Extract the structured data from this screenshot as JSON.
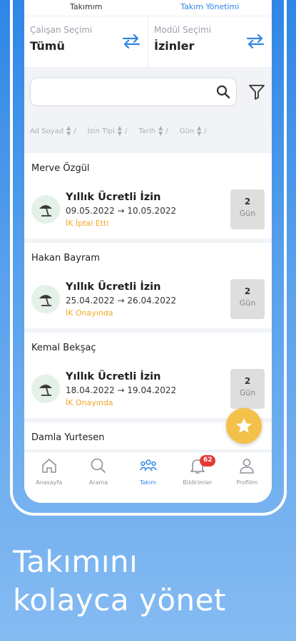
{
  "tabs": {
    "team": "Takımım",
    "management": "Takım Yönetimi"
  },
  "selectors": {
    "employee": {
      "label": "Çalışan Seçimi",
      "value": "Tümü"
    },
    "module": {
      "label": "Modül Seçimi",
      "value": "İzinler"
    }
  },
  "search": {
    "placeholder": ""
  },
  "sort_columns": [
    "Ad Soyad",
    "İzin Tipi",
    "Tarih",
    "Gün"
  ],
  "leaves": [
    {
      "name": "Merve Özgül",
      "type": "Yıllık Ücretli İzin",
      "dates": "09.05.2022 → 10.05.2022",
      "status": "İK İptal Etti",
      "days": "2",
      "unit": "Gün"
    },
    {
      "name": "Hakan Bayram",
      "type": "Yıllık Ücretli İzin",
      "dates": "25.04.2022 → 26.04.2022",
      "status": "İK Onayında",
      "days": "2",
      "unit": "Gün"
    },
    {
      "name": "Kemal Bekşaç",
      "type": "Yıllık Ücretli İzin",
      "dates": "18.04.2022 → 19.04.2022",
      "status": "İK Onayında",
      "days": "2",
      "unit": "Gün"
    },
    {
      "name": "Damla Yurtesen"
    }
  ],
  "nav": {
    "home": "Anasayfa",
    "search": "Arama",
    "team": "Takım",
    "notifications": "Bildirimler",
    "profile": "Profilim",
    "notification_count": "62"
  },
  "headline": {
    "line1": "Takımını",
    "line2": "kolayca yönet"
  },
  "colors": {
    "accent": "#2f86e6",
    "status": "#f0a928",
    "fab": "#f3c04a",
    "badge": "#e53935"
  }
}
